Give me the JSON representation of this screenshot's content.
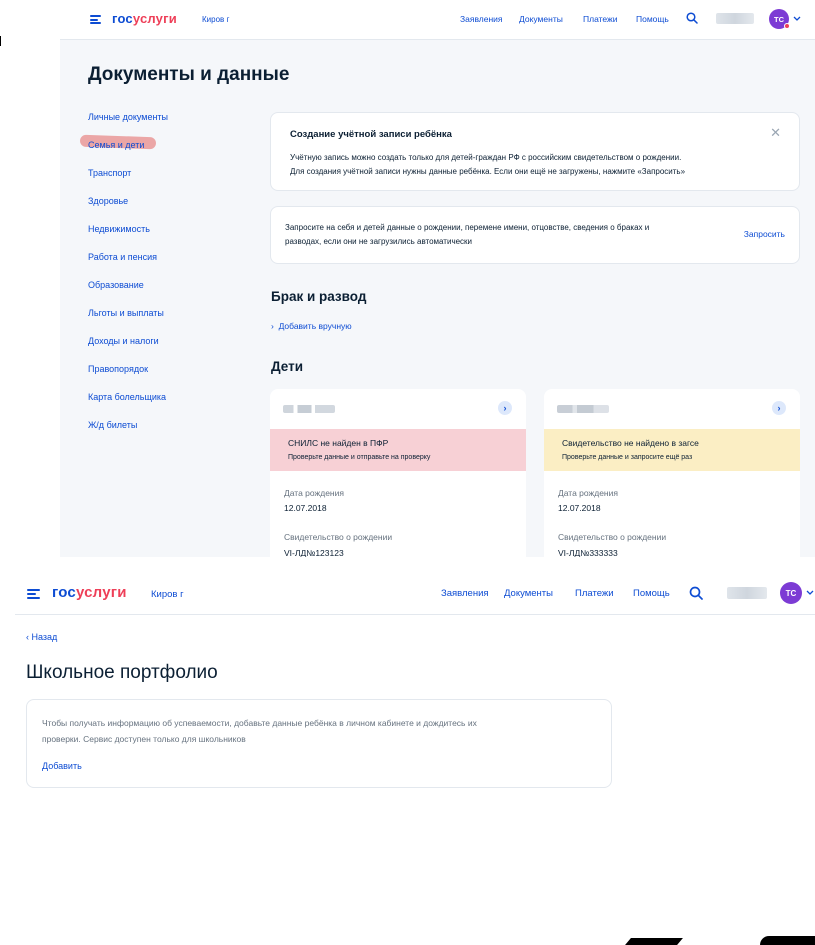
{
  "brand": {
    "gos": "гос",
    "uslugi": "услуги"
  },
  "colors": {
    "brand_blue": "#0d4cd3",
    "brand_red": "#ee3f58",
    "avatar": "#7c3bd4",
    "error_bg": "#f7d0d5",
    "warning_bg": "#fbeec4"
  },
  "screen1": {
    "header": {
      "city": "Киров г",
      "nav": [
        "Заявления",
        "Документы",
        "Платежи",
        "Помощь"
      ],
      "avatar_initials": "ТС",
      "icons": [
        "menu-icon",
        "search-icon",
        "chevron-down-icon"
      ]
    },
    "page_title": "Документы и данные",
    "sidebar": [
      {
        "label": "Личные документы",
        "active": false
      },
      {
        "label": "Семья и дети",
        "active": true
      },
      {
        "label": "Транспорт",
        "active": false
      },
      {
        "label": "Здоровье",
        "active": false
      },
      {
        "label": "Недвижимость",
        "active": false
      },
      {
        "label": "Работа и пенсия",
        "active": false
      },
      {
        "label": "Образование",
        "active": false
      },
      {
        "label": "Льготы и выплаты",
        "active": false
      },
      {
        "label": "Доходы и налоги",
        "active": false
      },
      {
        "label": "Правопорядок",
        "active": false
      },
      {
        "label": "Карта болельщика",
        "active": false
      },
      {
        "label": "Ж/д билеты",
        "active": false
      }
    ],
    "banner": {
      "title": "Создание учётной записи ребёнка",
      "line1": "Учётную запись можно создать только для детей-граждан РФ с российским свидетельством о рождении.",
      "line2": "Для создания учётной записи нужны данные ребёнка. Если они ещё не загружены, нажмите «Запросить»",
      "close": "✕"
    },
    "request": {
      "line1": "Запросите на себя и детей данные о рождении, перемене имени, отцовстве, сведения о браках и",
      "line2": "разводах, если они не загрузились автоматически",
      "link": "Запросить"
    },
    "marriage": {
      "heading": "Брак и развод",
      "add": "Добавить вручную"
    },
    "children": {
      "heading": "Дети",
      "cards": [
        {
          "status_title": "СНИЛС не найден в ПФР",
          "status_sub": "Проверьте данные и отправьте на проверку",
          "status": "error",
          "birth_label": "Дата рождения",
          "birth_value": "12.07.2018",
          "cert_label": "Свидетельство о рождении",
          "cert_value": "VI-ЛД№123123"
        },
        {
          "status_title": "Свидетельство не найдено в загсе",
          "status_sub": "Проверьте данные и запросите ещё раз",
          "status": "warning",
          "birth_label": "Дата рождения",
          "birth_value": "12.07.2018",
          "cert_label": "Свидетельство о рождении",
          "cert_value": "VI-ЛД№333333"
        }
      ]
    }
  },
  "screen2": {
    "header": {
      "city": "Киров г",
      "nav": [
        "Заявления",
        "Документы",
        "Платежи",
        "Помощь"
      ],
      "avatar_initials": "ТС"
    },
    "back": "‹ Назад",
    "page_title": "Школьное портфолио",
    "card": {
      "line1": "Чтобы получать информацию об успеваемости, добавьте данные ребёнка в личном кабинете и дождитесь их",
      "line2": "проверки. Сервис доступен только для школьников",
      "action": "Добавить"
    }
  }
}
